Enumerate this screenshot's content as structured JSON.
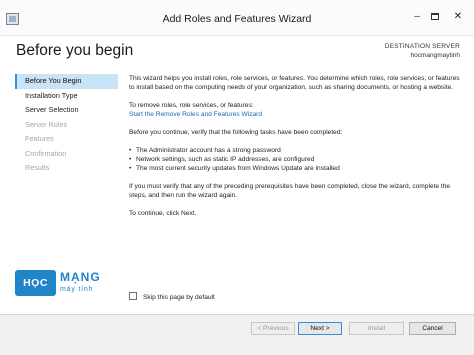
{
  "window": {
    "title": "Add Roles and Features Wizard",
    "controls": {
      "minimize": "–",
      "close": "✕"
    }
  },
  "header": {
    "page_title": "Before you begin",
    "destination_label": "DESTINATION SERVER",
    "destination_server": "hocmangmaytinh"
  },
  "nav": {
    "items": [
      {
        "label": "Before You Begin",
        "state": "active"
      },
      {
        "label": "Installation Type",
        "state": "enabled"
      },
      {
        "label": "Server Selection",
        "state": "enabled"
      },
      {
        "label": "Server Roles",
        "state": "disabled"
      },
      {
        "label": "Features",
        "state": "disabled"
      },
      {
        "label": "Confirmation",
        "state": "disabled"
      },
      {
        "label": "Results",
        "state": "disabled"
      }
    ]
  },
  "logo": {
    "badge": "HỌC",
    "word": "MẠNG",
    "sub": "máy tính"
  },
  "content": {
    "intro": "This wizard helps you install roles, role services, or features. You determine which roles, role services, or features to install based on the computing needs of your organization, such as sharing documents, or hosting a website.",
    "remove_text": "To remove roles, role services, or features:",
    "remove_link": "Start the Remove Roles and Features Wizard",
    "verify_text": "Before you continue, verify that the following tasks have been completed:",
    "bullets": [
      "The Administrator account has a strong password",
      "Network settings, such as static IP addresses, are configured",
      "The most current security updates from Windows Update are installed"
    ],
    "prereq_text": "If you must verify that any of the preceding prerequisites have been completed, close the wizard, complete the steps, and then run the wizard again.",
    "continue_text": "To continue, click Next."
  },
  "skip_checkbox": {
    "label": "Skip this page by default",
    "checked": false
  },
  "footer": {
    "previous": "< Previous",
    "next": "Next >",
    "install": "Install",
    "cancel": "Cancel"
  },
  "colors": {
    "accent": "#3c8dd1",
    "nav_active_bg": "#c9e4f7",
    "link": "#1c65b5",
    "logo": "#1f84c8"
  }
}
